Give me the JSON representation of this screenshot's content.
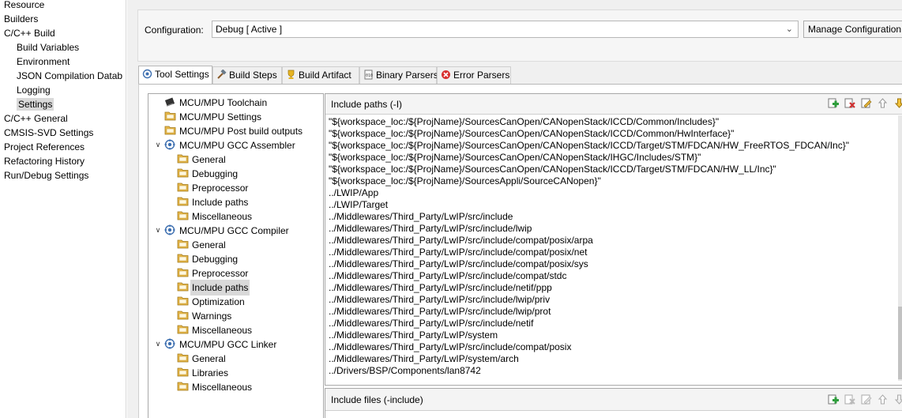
{
  "nav": {
    "items": [
      {
        "label": "Resource",
        "level": 0
      },
      {
        "label": "Builders",
        "level": 0
      },
      {
        "label": "C/C++ Build",
        "level": 0
      },
      {
        "label": "Build Variables",
        "level": 1
      },
      {
        "label": "Environment",
        "level": 1
      },
      {
        "label": "JSON Compilation Datab",
        "level": 1
      },
      {
        "label": "Logging",
        "level": 1
      },
      {
        "label": "Settings",
        "level": 1,
        "selected": true
      },
      {
        "label": "C/C++ General",
        "level": 0
      },
      {
        "label": "CMSIS-SVD Settings",
        "level": 0
      },
      {
        "label": "Project References",
        "level": 0
      },
      {
        "label": "Refactoring History",
        "level": 0
      },
      {
        "label": "Run/Debug Settings",
        "level": 0
      }
    ]
  },
  "config": {
    "label": "Configuration:",
    "value": "Debug  [ Active ]",
    "manage_label": "Manage Configuration"
  },
  "tabs": [
    {
      "label": "Tool Settings",
      "icon": "gear-icon",
      "active": true
    },
    {
      "label": "Build Steps",
      "icon": "hammer-icon"
    },
    {
      "label": "Build Artifact",
      "icon": "trophy-icon"
    },
    {
      "label": "Binary Parsers",
      "icon": "binary-file-icon"
    },
    {
      "label": "Error Parsers",
      "icon": "error-icon"
    }
  ],
  "tree": [
    {
      "label": "MCU/MPU Toolchain",
      "icon": "chip-icon",
      "depth": 0
    },
    {
      "label": "MCU/MPU Settings",
      "icon": "folder-icon",
      "depth": 0
    },
    {
      "label": "MCU/MPU Post build outputs",
      "icon": "folder-icon",
      "depth": 0
    },
    {
      "label": "MCU/MPU GCC Assembler",
      "icon": "gear-icon",
      "depth": 0,
      "expanded": true
    },
    {
      "label": "General",
      "icon": "folder-icon",
      "depth": 1
    },
    {
      "label": "Debugging",
      "icon": "folder-icon",
      "depth": 1
    },
    {
      "label": "Preprocessor",
      "icon": "folder-icon",
      "depth": 1
    },
    {
      "label": "Include paths",
      "icon": "folder-icon",
      "depth": 1
    },
    {
      "label": "Miscellaneous",
      "icon": "folder-icon",
      "depth": 1
    },
    {
      "label": "MCU/MPU GCC Compiler",
      "icon": "gear-icon",
      "depth": 0,
      "expanded": true
    },
    {
      "label": "General",
      "icon": "folder-icon",
      "depth": 1
    },
    {
      "label": "Debugging",
      "icon": "folder-icon",
      "depth": 1
    },
    {
      "label": "Preprocessor",
      "icon": "folder-icon",
      "depth": 1
    },
    {
      "label": "Include paths",
      "icon": "folder-icon",
      "depth": 1,
      "selected": true
    },
    {
      "label": "Optimization",
      "icon": "folder-icon",
      "depth": 1
    },
    {
      "label": "Warnings",
      "icon": "folder-icon",
      "depth": 1
    },
    {
      "label": "Miscellaneous",
      "icon": "folder-icon",
      "depth": 1
    },
    {
      "label": "MCU/MPU GCC Linker",
      "icon": "gear-icon",
      "depth": 0,
      "expanded": true
    },
    {
      "label": "General",
      "icon": "folder-icon",
      "depth": 1
    },
    {
      "label": "Libraries",
      "icon": "folder-icon",
      "depth": 1
    },
    {
      "label": "Miscellaneous",
      "icon": "folder-icon",
      "depth": 1
    }
  ],
  "include_paths": {
    "title": "Include paths (-I)",
    "items": [
      "\"${workspace_loc:/${ProjName}/SourcesCanOpen/CANopenStack/ICCD/Common/Includes}\"",
      "\"${workspace_loc:/${ProjName}/SourcesCanOpen/CANopenStack/ICCD/Common/HwInterface}\"",
      "\"${workspace_loc:/${ProjName}/SourcesCanOpen/CANopenStack/ICCD/Target/STM/FDCAN/HW_FreeRTOS_FDCAN/Inc}\"",
      "\"${workspace_loc:/${ProjName}/SourcesCanOpen/CANopenStack/IHGC/Includes/STM}\"",
      "\"${workspace_loc:/${ProjName}/SourcesCanOpen/CANopenStack/ICCD/Target/STM/FDCAN/HW_LL/Inc}\"",
      "\"${workspace_loc:/${ProjName}/SourcesAppli/SourceCANopen}\"",
      "../LWIP/App",
      "../LWIP/Target",
      "../Middlewares/Third_Party/LwIP/src/include",
      "../Middlewares/Third_Party/LwIP/src/include/lwip",
      "../Middlewares/Third_Party/LwIP/src/include/compat/posix/arpa",
      "../Middlewares/Third_Party/LwIP/src/include/compat/posix/net",
      "../Middlewares/Third_Party/LwIP/src/include/compat/posix/sys",
      "../Middlewares/Third_Party/LwIP/src/include/compat/stdc",
      "../Middlewares/Third_Party/LwIP/src/include/netif/ppp",
      "../Middlewares/Third_Party/LwIP/src/include/lwip/priv",
      "../Middlewares/Third_Party/LwIP/src/include/lwip/prot",
      "../Middlewares/Third_Party/LwIP/src/include/netif",
      "../Middlewares/Third_Party/LwIP/system",
      "../Middlewares/Third_Party/LwIP/src/include/compat/posix",
      "../Middlewares/Third_Party/LwIP/system/arch",
      "../Drivers/BSP/Components/lan8742"
    ]
  },
  "include_files": {
    "title": "Include files (-include)"
  },
  "colors": {
    "selection": "#d9d9d9",
    "folder": "#e8b84a",
    "gear": "#3d6fb0",
    "add": "#2e9e3c",
    "delete": "#d03030"
  }
}
